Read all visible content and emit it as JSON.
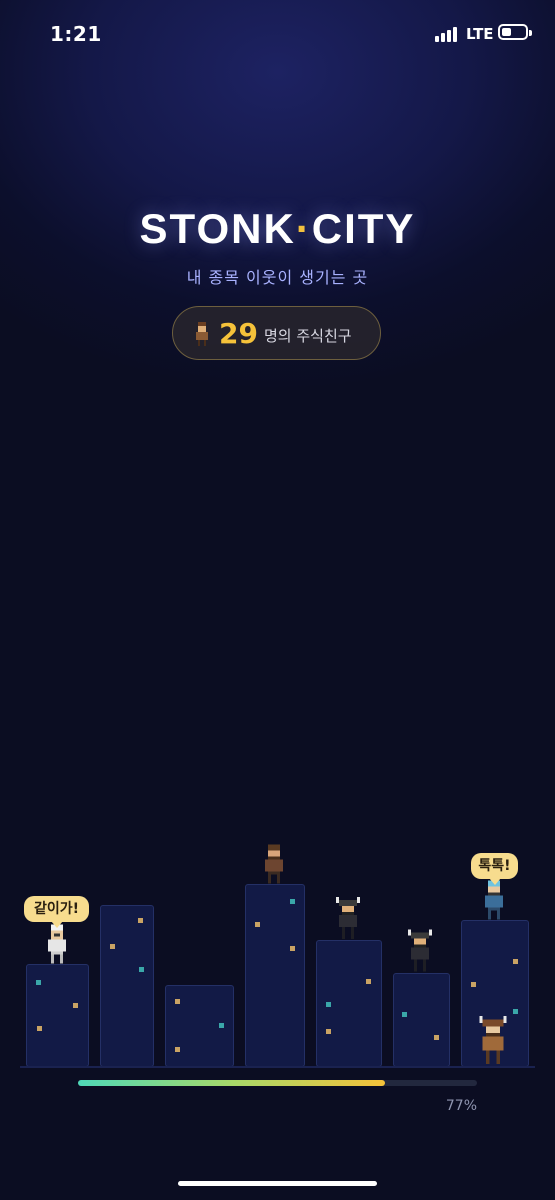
{
  "status_bar": {
    "time": "1:21",
    "network": "LTE",
    "signal_icon": "signal-bars-icon",
    "battery_icon": "battery-icon"
  },
  "header": {
    "title_left": "STONK",
    "title_dot": "·",
    "title_right": "CITY",
    "subtitle": "내 종목 이웃이 생기는 곳"
  },
  "friends": {
    "count": "29",
    "label": "명의 주식친구",
    "avatar_icon": "pixel-character-icon"
  },
  "speech_bubbles": {
    "left": "같이가!",
    "right": "톡톡!"
  },
  "progress": {
    "value": 0.77,
    "label": "77%"
  },
  "colors": {
    "accent": "#f5c23a",
    "subtitle": "#a9b2ff",
    "window_gold": "#c9a364",
    "window_teal": "#3aa7a9"
  }
}
